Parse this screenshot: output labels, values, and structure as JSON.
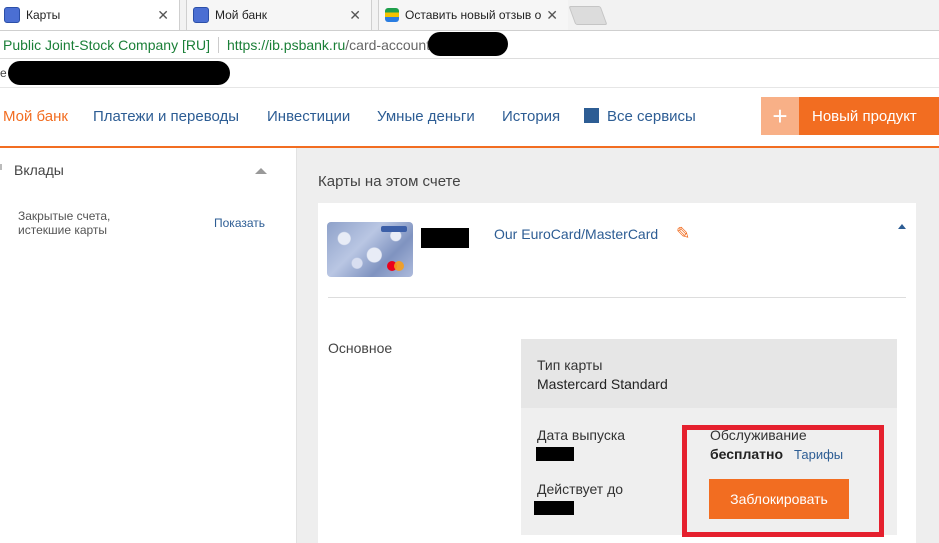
{
  "tabs": [
    {
      "title": "Карты",
      "active": true
    },
    {
      "title": "Мой банк",
      "active": false
    },
    {
      "title": "Оставить новый отзыв о",
      "active": false
    }
  ],
  "address": {
    "org": "Public Joint-Stock Company [RU]",
    "scheme": "https://",
    "host": "ib.psbank.ru",
    "path": "/card-account"
  },
  "bookmarks_char": "е",
  "nav": {
    "items": [
      "Мой банк",
      "Платежи и переводы",
      "Инвестиции",
      "Умные деньги",
      "История"
    ],
    "all_services": "Все сервисы",
    "new_product": "Новый продукт",
    "plus": "+"
  },
  "sidebar": {
    "section": "Вклады",
    "closed_line1": "Закрытые счета,",
    "closed_line2": "истекшие карты",
    "show": "Показать"
  },
  "main": {
    "heading": "Карты на этом счете",
    "card_name": "Our EuroCard/MasterCard",
    "section_label": "Основное",
    "card_type_label": "Тип карты",
    "card_type_value": "Mastercard Standard",
    "issue_date_label": "Дата выпуска",
    "valid_until_label": "Действует до",
    "service_label": "Обслуживание",
    "service_value": "бесплатно",
    "tariffs": "Тарифы",
    "block_button": "Заблокировать"
  },
  "colors": {
    "accent": "#f26d21",
    "link": "#2d5d94",
    "highlight": "#e5202e"
  }
}
